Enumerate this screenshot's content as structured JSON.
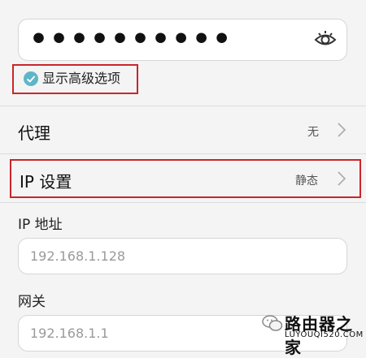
{
  "password": {
    "masked_value": "••••••••••"
  },
  "advanced": {
    "label": "显示高级选项",
    "checked": true
  },
  "proxy": {
    "label": "代理",
    "value": "无"
  },
  "ip_settings": {
    "label": "IP 设置",
    "value": "静态"
  },
  "ip_address": {
    "label": "IP 地址",
    "placeholder": "192.168.1.128"
  },
  "gateway": {
    "label": "网关",
    "placeholder": "192.168.1.1"
  },
  "watermark": {
    "title": "路由器之家",
    "url": "LUYOUQI520.COM"
  },
  "colors": {
    "highlight": "#c9262a",
    "accent": "#5cb6c8"
  }
}
